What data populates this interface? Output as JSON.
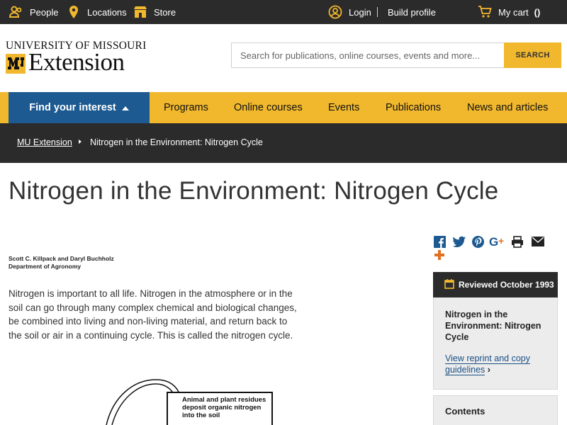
{
  "topbar": {
    "people_label": "People",
    "locations_label": "Locations",
    "store_label": "Store",
    "login_label": "Login",
    "build_profile_label": "Build profile",
    "cart_label": "My cart",
    "cart_count": "()"
  },
  "logo": {
    "line1": "UNIVERSITY OF MISSOURI",
    "line2": "Extension"
  },
  "search": {
    "placeholder": "Search for publications, online courses, events and more...",
    "button_label": "SEARCH"
  },
  "nav": {
    "find_label": "Find your interest",
    "items": [
      "Programs",
      "Online courses",
      "Events",
      "Publications",
      "News and articles"
    ]
  },
  "breadcrumb": {
    "home": "MU Extension",
    "current": "Nitrogen in the Environment: Nitrogen Cycle"
  },
  "page": {
    "title": "Nitrogen in the Environment: Nitrogen Cycle",
    "authors": "Scott C. Killpack and Daryl Buchholz",
    "department": "Department of Agronomy",
    "body": "Nitrogen is important to all life. Nitrogen in the atmosphere or in the soil can go through many complex chemical and biological changes, be combined into living and non-living material, and return back to the soil or air in a continuing cycle. This is called the nitrogen cycle."
  },
  "diagram": {
    "label": "Animal and plant residues deposit organic nitrogen into the soil"
  },
  "share": {
    "icons": [
      "facebook-icon",
      "twitter-icon",
      "pinterest-icon",
      "google-plus-icon",
      "print-icon",
      "email-icon",
      "plus-icon"
    ]
  },
  "sidebar": {
    "reviewed": "Reviewed October 1993",
    "pub_title": "Nitrogen in the Environment: Nitrogen Cycle",
    "reprint_link": "View reprint and copy guidelines",
    "contents_title": "Contents"
  },
  "colors": {
    "gold": "#f1b82d",
    "dark": "#2b2b2b",
    "blue": "#1c5a91",
    "share_blue": "#1c5a91",
    "share_orange": "#e07020"
  }
}
